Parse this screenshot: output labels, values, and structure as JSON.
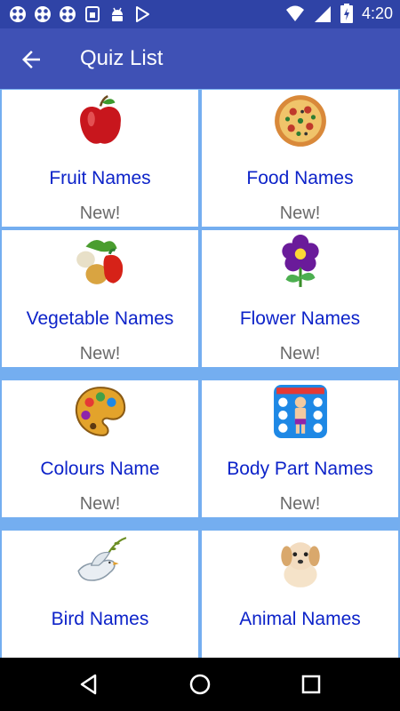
{
  "status_bar": {
    "time": "4:20",
    "left_icons": [
      "app-icon",
      "app-icon",
      "app-icon",
      "sim-icon",
      "android-icon",
      "play-store-icon"
    ],
    "right_icons": [
      "wifi-icon",
      "signal-icon",
      "battery-charging-icon"
    ]
  },
  "app_bar": {
    "title": "Quiz List",
    "back_icon": "arrow-back-icon",
    "color": "#3f51b5"
  },
  "quizzes": [
    {
      "name": "Fruit Names",
      "badge": "New!",
      "icon": "apple-icon"
    },
    {
      "name": "Food Names",
      "badge": "New!",
      "icon": "pizza-icon"
    },
    {
      "name": "Vegetable Names",
      "badge": "New!",
      "icon": "vegetables-icon"
    },
    {
      "name": "Flower Names",
      "badge": "New!",
      "icon": "flower-icon"
    },
    {
      "name": "Colours Name",
      "badge": "New!",
      "icon": "paint-palette-icon"
    },
    {
      "name": "Body Part Names",
      "badge": "New!",
      "icon": "body-parts-icon"
    },
    {
      "name": "Bird Names",
      "badge": "",
      "icon": "dove-icon"
    },
    {
      "name": "Animal Names",
      "badge": "",
      "icon": "puppy-icon"
    }
  ],
  "nav_bar": {
    "back_icon": "nav-back-icon",
    "home_icon": "nav-home-icon",
    "recents_icon": "nav-recents-icon"
  },
  "colors": {
    "accent": "#3f51b5",
    "status_bar": "#2f43a6",
    "grid_border": "#74aef0",
    "item_text": "#0d23c9",
    "badge_text": "#6b6b6b"
  }
}
